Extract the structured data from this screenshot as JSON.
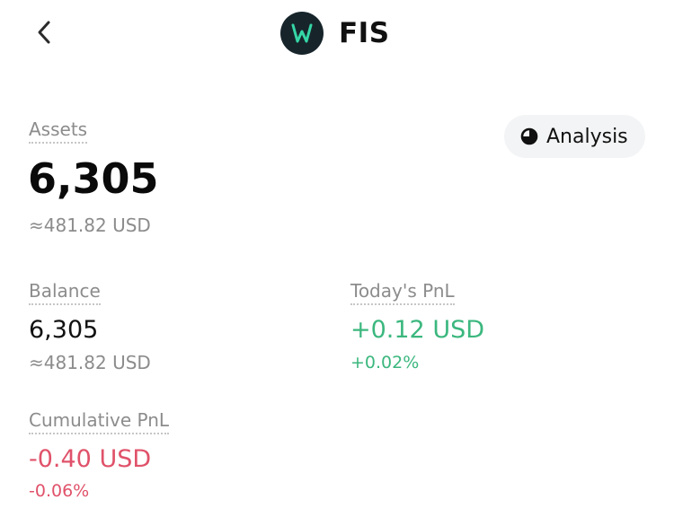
{
  "header": {
    "token_name": "FIS",
    "logo_letter": "W",
    "logo_bg": "#17252b",
    "logo_accent": "#35d6a6",
    "back_icon": "chevron-left-icon"
  },
  "analysis_button": {
    "label": "Analysis",
    "icon": "pie-chart-icon"
  },
  "assets": {
    "label": "Assets",
    "value": "6,305",
    "usd": "≈481.82 USD"
  },
  "balance": {
    "label": "Balance",
    "value": "6,305",
    "usd": "≈481.82 USD"
  },
  "todays_pnl": {
    "label": "Today's PnL",
    "value": "+0.12 USD",
    "percent": "+0.02%",
    "color": "#3bb77e"
  },
  "cumulative_pnl": {
    "label": "Cumulative PnL",
    "value": "-0.40 USD",
    "percent": "-0.06%",
    "color": "#e0526a"
  }
}
